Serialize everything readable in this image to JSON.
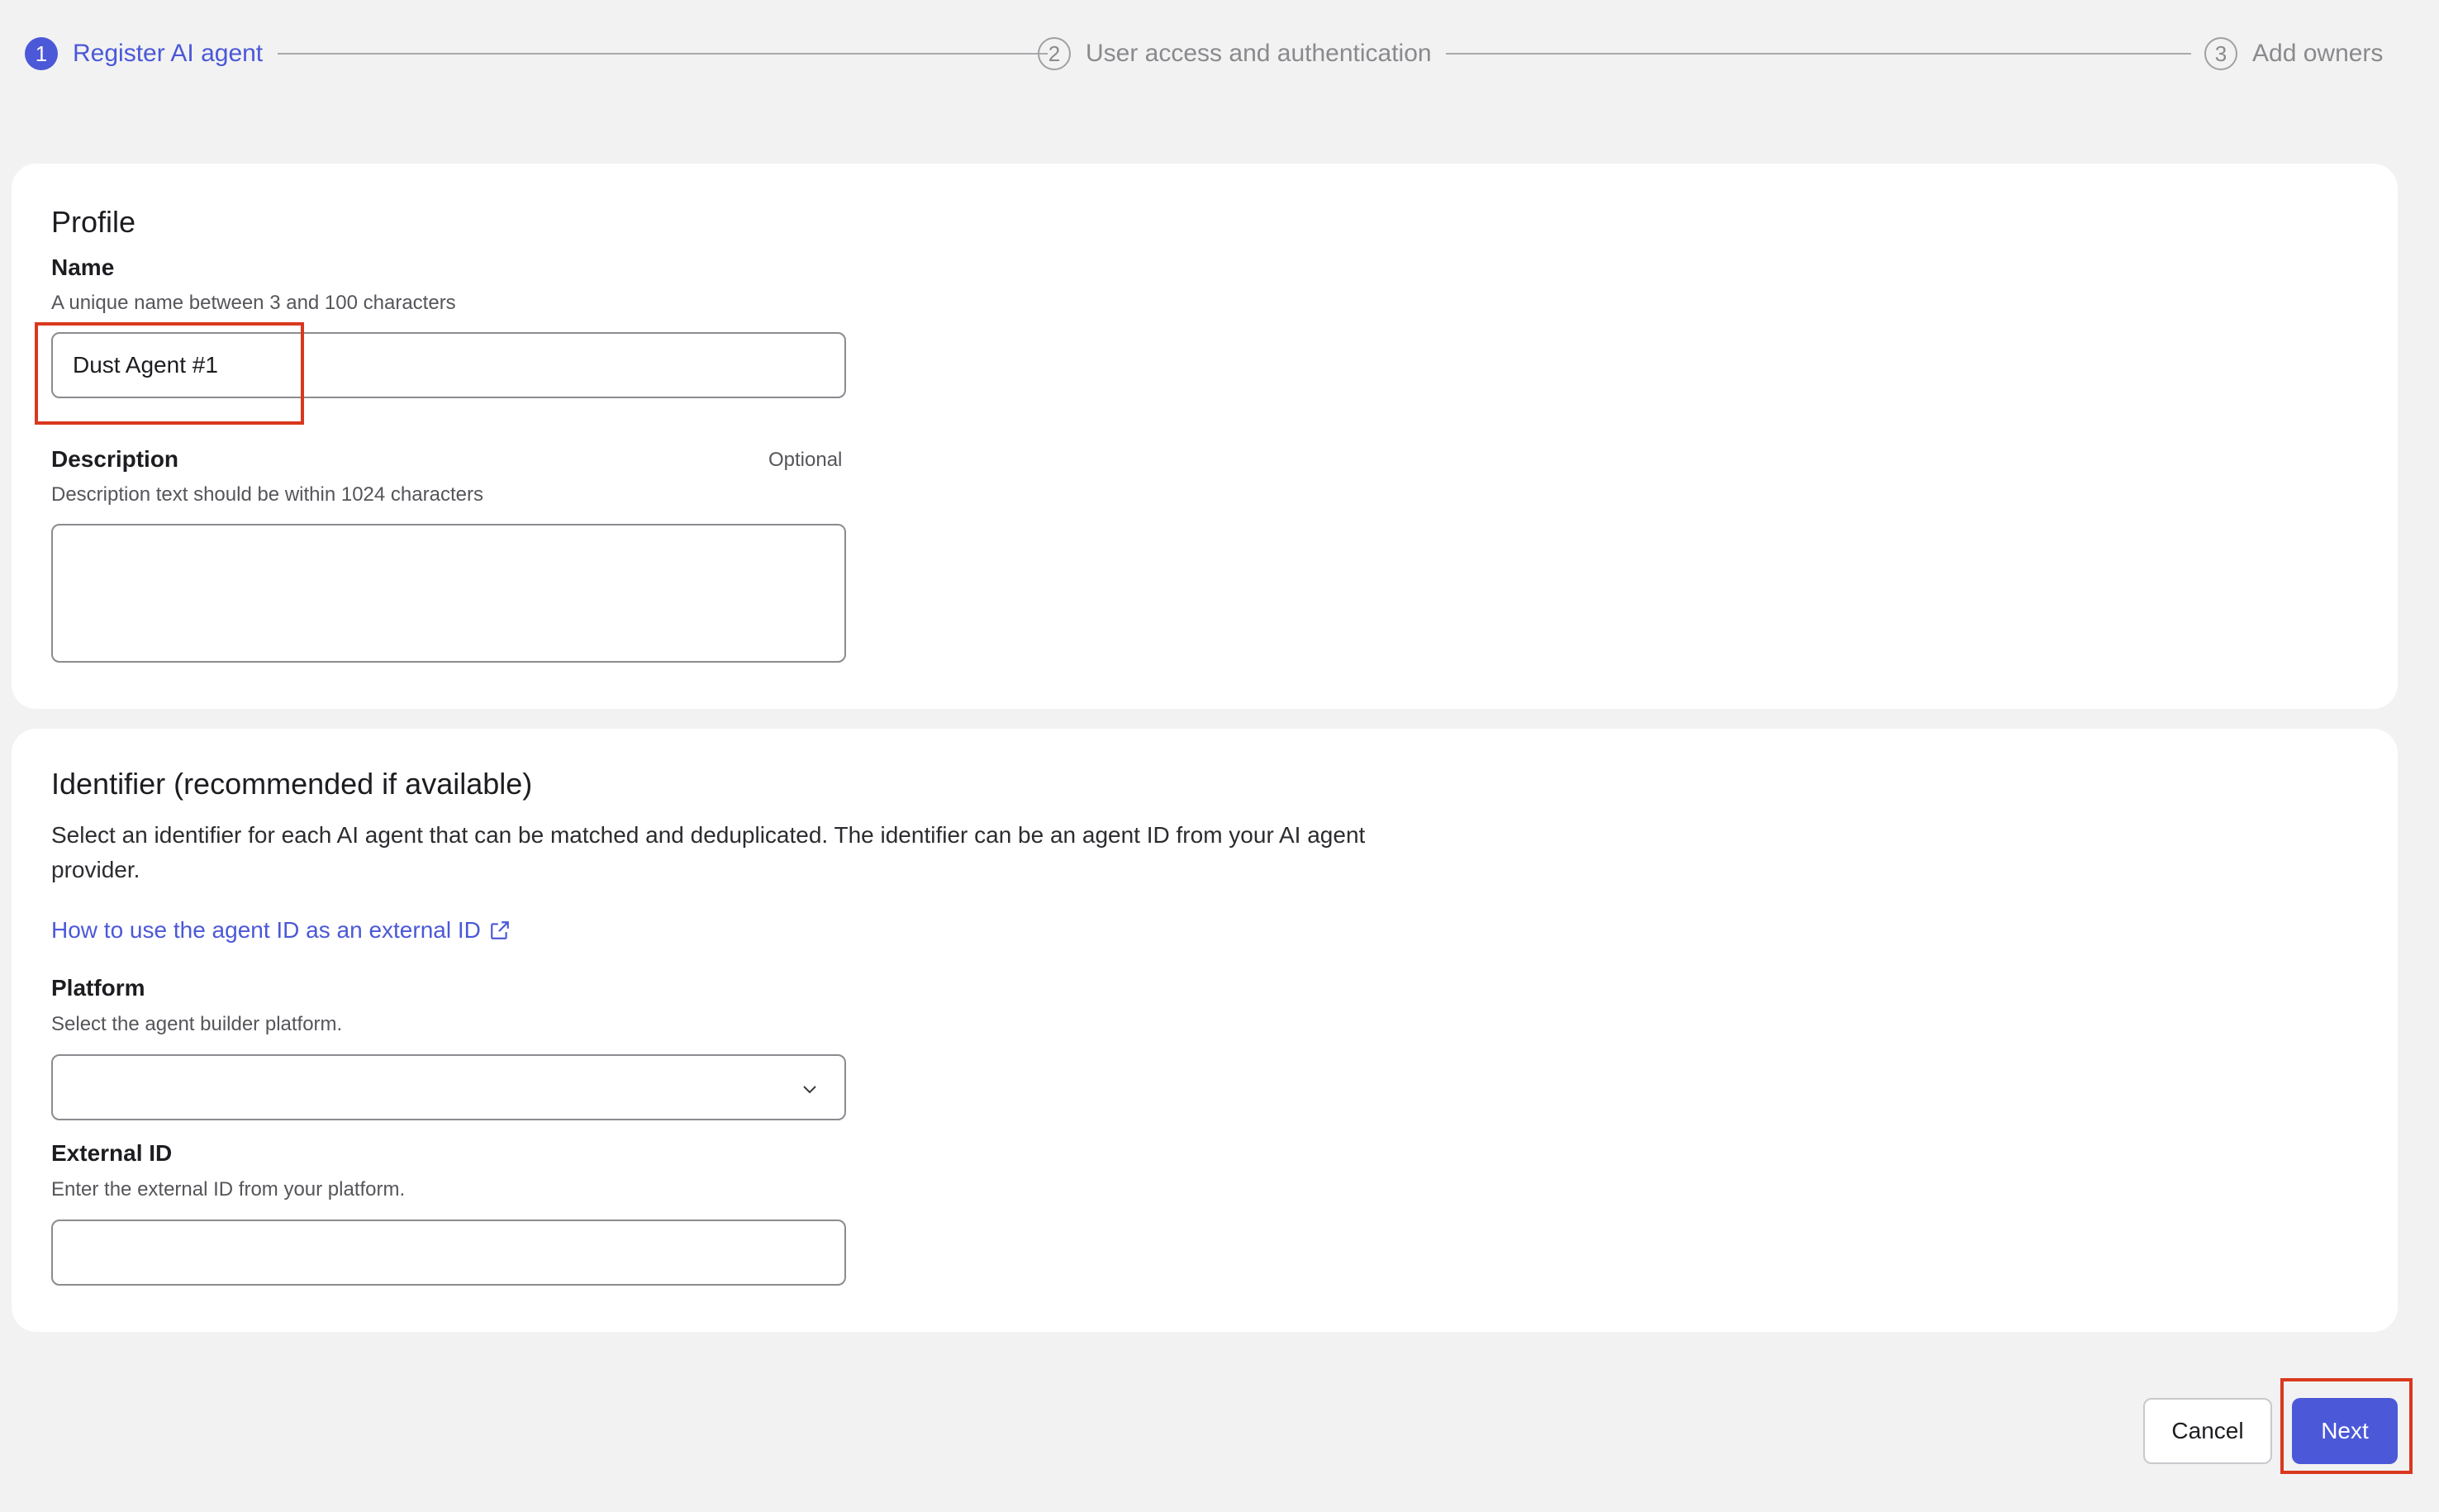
{
  "stepper": {
    "steps": [
      {
        "number": "1",
        "label": "Register AI agent",
        "state": "active"
      },
      {
        "number": "2",
        "label": "User access and authentication",
        "state": "inactive"
      },
      {
        "number": "3",
        "label": "Add owners",
        "state": "inactive"
      }
    ]
  },
  "profile": {
    "title": "Profile",
    "name": {
      "label": "Name",
      "help": "A unique name between 3 and 100 characters",
      "value": "Dust Agent #1"
    },
    "description": {
      "label": "Description",
      "optional": "Optional",
      "help": "Description text should be within 1024 characters",
      "value": ""
    }
  },
  "identifier": {
    "title": "Identifier (recommended if available)",
    "body": "Select an identifier for each AI agent that can be matched and deduplicated. The identifier can be an agent ID from your AI agent provider.",
    "link": "How to use the agent ID as an external ID",
    "platform": {
      "label": "Platform",
      "help": "Select the agent builder platform.",
      "value": ""
    },
    "external_id": {
      "label": "External ID",
      "help": "Enter the external ID from your platform.",
      "value": ""
    }
  },
  "actions": {
    "cancel": "Cancel",
    "next": "Next"
  },
  "colors": {
    "accent": "#4b58d8",
    "highlight": "#d9381e",
    "background": "#f2f2f2"
  },
  "icons": [
    "external-link-icon",
    "chevron-down-icon"
  ]
}
